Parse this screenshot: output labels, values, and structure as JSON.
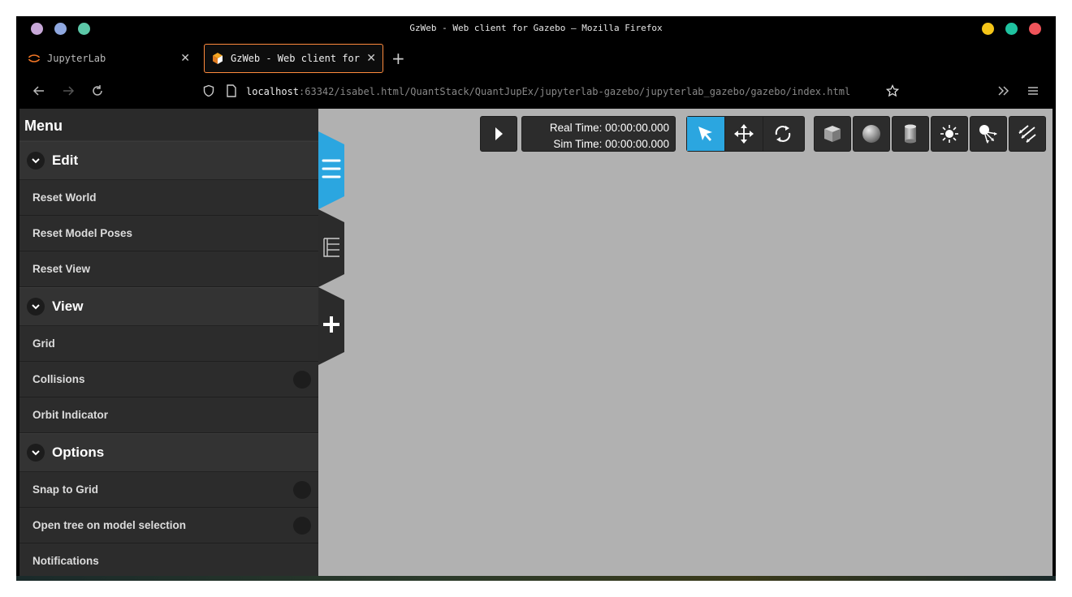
{
  "window": {
    "title": "GzWeb - Web client for Gazebo — Mozilla Firefox",
    "controls_left": [
      "#c8a8d8",
      "#8fa8e0",
      "#5cc8a8"
    ],
    "controls_right": [
      "#f5c518",
      "#1fc3a0",
      "#f0545a"
    ]
  },
  "tabs": [
    {
      "label": "JupyterLab",
      "icon": "jupyter-icon",
      "active": false
    },
    {
      "label": "GzWeb - Web client for",
      "icon": "gazebo-icon",
      "active": true
    }
  ],
  "tab_close_glyph": "✕",
  "newtab_glyph": "+",
  "address": {
    "host": "localhost",
    "path": ":63342/isabel.html/QuantStack/QuantJupEx/jupyterlab-gazebo/jupyterlab_gazebo/gazebo/index.html"
  },
  "menu": {
    "title": "Menu",
    "sections": [
      {
        "label": "Edit",
        "items": [
          "Reset World",
          "Reset Model Poses",
          "Reset View"
        ]
      },
      {
        "label": "View",
        "items": [
          "Grid",
          "Collisions",
          "Orbit Indicator"
        ]
      },
      {
        "label": "Options",
        "items": [
          "Snap to Grid",
          "Open tree on model selection",
          "Notifications"
        ]
      }
    ]
  },
  "time": {
    "real": "Real Time: 00:00:00.000",
    "sim": "Sim Time: 00:00:00.000"
  },
  "toolbar": {
    "modes": [
      "select-icon",
      "translate-icon",
      "rotate-icon"
    ],
    "active_mode": "select-icon",
    "shapes": [
      "box-icon",
      "sphere-icon",
      "cylinder-icon",
      "point-light-icon",
      "spot-light-icon",
      "directional-light-icon"
    ]
  },
  "colors": {
    "accent": "#2ba6e0",
    "tab_active_border": "#ff8a3c",
    "viewport": "#b1b1b1"
  }
}
